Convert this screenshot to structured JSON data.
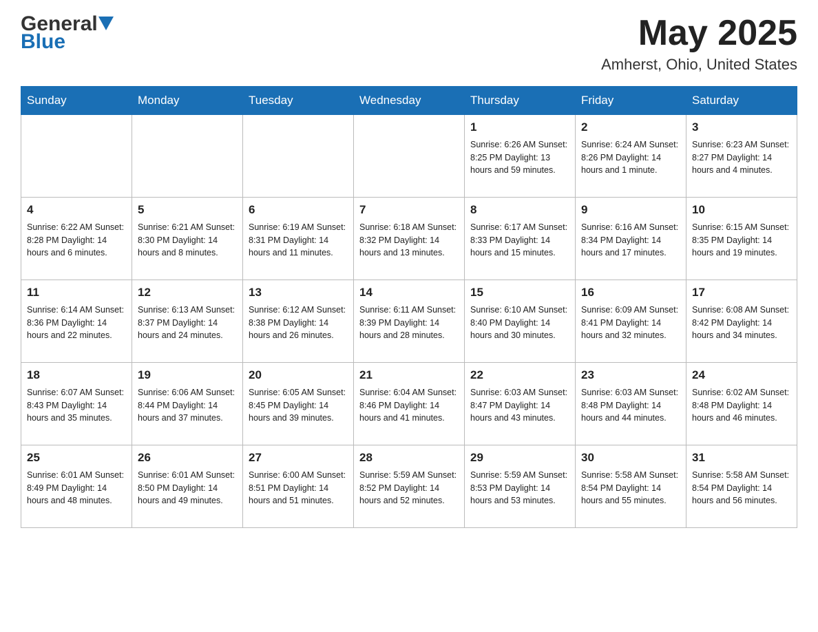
{
  "header": {
    "logo_text": "General",
    "logo_blue": "Blue",
    "month_title": "May 2025",
    "location": "Amherst, Ohio, United States"
  },
  "days_of_week": [
    "Sunday",
    "Monday",
    "Tuesday",
    "Wednesday",
    "Thursday",
    "Friday",
    "Saturday"
  ],
  "weeks": [
    [
      {
        "day": "",
        "info": ""
      },
      {
        "day": "",
        "info": ""
      },
      {
        "day": "",
        "info": ""
      },
      {
        "day": "",
        "info": ""
      },
      {
        "day": "1",
        "info": "Sunrise: 6:26 AM\nSunset: 8:25 PM\nDaylight: 13 hours\nand 59 minutes."
      },
      {
        "day": "2",
        "info": "Sunrise: 6:24 AM\nSunset: 8:26 PM\nDaylight: 14 hours\nand 1 minute."
      },
      {
        "day": "3",
        "info": "Sunrise: 6:23 AM\nSunset: 8:27 PM\nDaylight: 14 hours\nand 4 minutes."
      }
    ],
    [
      {
        "day": "4",
        "info": "Sunrise: 6:22 AM\nSunset: 8:28 PM\nDaylight: 14 hours\nand 6 minutes."
      },
      {
        "day": "5",
        "info": "Sunrise: 6:21 AM\nSunset: 8:30 PM\nDaylight: 14 hours\nand 8 minutes."
      },
      {
        "day": "6",
        "info": "Sunrise: 6:19 AM\nSunset: 8:31 PM\nDaylight: 14 hours\nand 11 minutes."
      },
      {
        "day": "7",
        "info": "Sunrise: 6:18 AM\nSunset: 8:32 PM\nDaylight: 14 hours\nand 13 minutes."
      },
      {
        "day": "8",
        "info": "Sunrise: 6:17 AM\nSunset: 8:33 PM\nDaylight: 14 hours\nand 15 minutes."
      },
      {
        "day": "9",
        "info": "Sunrise: 6:16 AM\nSunset: 8:34 PM\nDaylight: 14 hours\nand 17 minutes."
      },
      {
        "day": "10",
        "info": "Sunrise: 6:15 AM\nSunset: 8:35 PM\nDaylight: 14 hours\nand 19 minutes."
      }
    ],
    [
      {
        "day": "11",
        "info": "Sunrise: 6:14 AM\nSunset: 8:36 PM\nDaylight: 14 hours\nand 22 minutes."
      },
      {
        "day": "12",
        "info": "Sunrise: 6:13 AM\nSunset: 8:37 PM\nDaylight: 14 hours\nand 24 minutes."
      },
      {
        "day": "13",
        "info": "Sunrise: 6:12 AM\nSunset: 8:38 PM\nDaylight: 14 hours\nand 26 minutes."
      },
      {
        "day": "14",
        "info": "Sunrise: 6:11 AM\nSunset: 8:39 PM\nDaylight: 14 hours\nand 28 minutes."
      },
      {
        "day": "15",
        "info": "Sunrise: 6:10 AM\nSunset: 8:40 PM\nDaylight: 14 hours\nand 30 minutes."
      },
      {
        "day": "16",
        "info": "Sunrise: 6:09 AM\nSunset: 8:41 PM\nDaylight: 14 hours\nand 32 minutes."
      },
      {
        "day": "17",
        "info": "Sunrise: 6:08 AM\nSunset: 8:42 PM\nDaylight: 14 hours\nand 34 minutes."
      }
    ],
    [
      {
        "day": "18",
        "info": "Sunrise: 6:07 AM\nSunset: 8:43 PM\nDaylight: 14 hours\nand 35 minutes."
      },
      {
        "day": "19",
        "info": "Sunrise: 6:06 AM\nSunset: 8:44 PM\nDaylight: 14 hours\nand 37 minutes."
      },
      {
        "day": "20",
        "info": "Sunrise: 6:05 AM\nSunset: 8:45 PM\nDaylight: 14 hours\nand 39 minutes."
      },
      {
        "day": "21",
        "info": "Sunrise: 6:04 AM\nSunset: 8:46 PM\nDaylight: 14 hours\nand 41 minutes."
      },
      {
        "day": "22",
        "info": "Sunrise: 6:03 AM\nSunset: 8:47 PM\nDaylight: 14 hours\nand 43 minutes."
      },
      {
        "day": "23",
        "info": "Sunrise: 6:03 AM\nSunset: 8:48 PM\nDaylight: 14 hours\nand 44 minutes."
      },
      {
        "day": "24",
        "info": "Sunrise: 6:02 AM\nSunset: 8:48 PM\nDaylight: 14 hours\nand 46 minutes."
      }
    ],
    [
      {
        "day": "25",
        "info": "Sunrise: 6:01 AM\nSunset: 8:49 PM\nDaylight: 14 hours\nand 48 minutes."
      },
      {
        "day": "26",
        "info": "Sunrise: 6:01 AM\nSunset: 8:50 PM\nDaylight: 14 hours\nand 49 minutes."
      },
      {
        "day": "27",
        "info": "Sunrise: 6:00 AM\nSunset: 8:51 PM\nDaylight: 14 hours\nand 51 minutes."
      },
      {
        "day": "28",
        "info": "Sunrise: 5:59 AM\nSunset: 8:52 PM\nDaylight: 14 hours\nand 52 minutes."
      },
      {
        "day": "29",
        "info": "Sunrise: 5:59 AM\nSunset: 8:53 PM\nDaylight: 14 hours\nand 53 minutes."
      },
      {
        "day": "30",
        "info": "Sunrise: 5:58 AM\nSunset: 8:54 PM\nDaylight: 14 hours\nand 55 minutes."
      },
      {
        "day": "31",
        "info": "Sunrise: 5:58 AM\nSunset: 8:54 PM\nDaylight: 14 hours\nand 56 minutes."
      }
    ]
  ]
}
